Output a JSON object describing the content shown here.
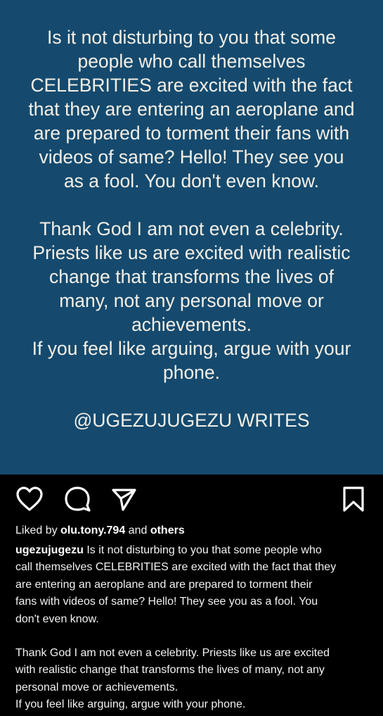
{
  "post_image": {
    "paragraph1": "Is it not disturbing to you that some\npeople who call themselves\nCELEBRITIES are excited with the fact\nthat they are entering an aeroplane and\nare prepared to torment their fans with\nvideos of same? Hello! They see you\nas a fool. You don't even know.",
    "paragraph2": "Thank God I am not even a celebrity.\nPriests like us are excited with realistic\nchange that transforms the lives of\nmany, not any personal move or\nachievements.\nIf you feel like arguing, argue with your\nphone.",
    "signature": "@UGEZUJUGEZU WRITES",
    "background_color": "#154a6e",
    "text_color": "#f4efe6"
  },
  "actions": {
    "like_icon": "heart-icon",
    "comment_icon": "comment-icon",
    "share_icon": "send-icon",
    "save_icon": "bookmark-icon"
  },
  "likes": {
    "prefix": "Liked by ",
    "user": "olu.tony.794",
    "middle": " and ",
    "others": "others"
  },
  "caption": {
    "username": "ugezujugezu",
    "paragraph1": " Is it not disturbing to you that some people who\ncall themselves CELEBRITIES are excited with the fact that they\nare entering an aeroplane and are prepared to torment their\nfans with videos of same? Hello! They see you as a fool. You\ndon't even know.",
    "paragraph2": "Thank God I am not even a celebrity. Priests like us are excited\nwith realistic change that transforms the lives of many, not any\npersonal move or achievements.\nIf you feel like arguing, argue with your phone."
  }
}
